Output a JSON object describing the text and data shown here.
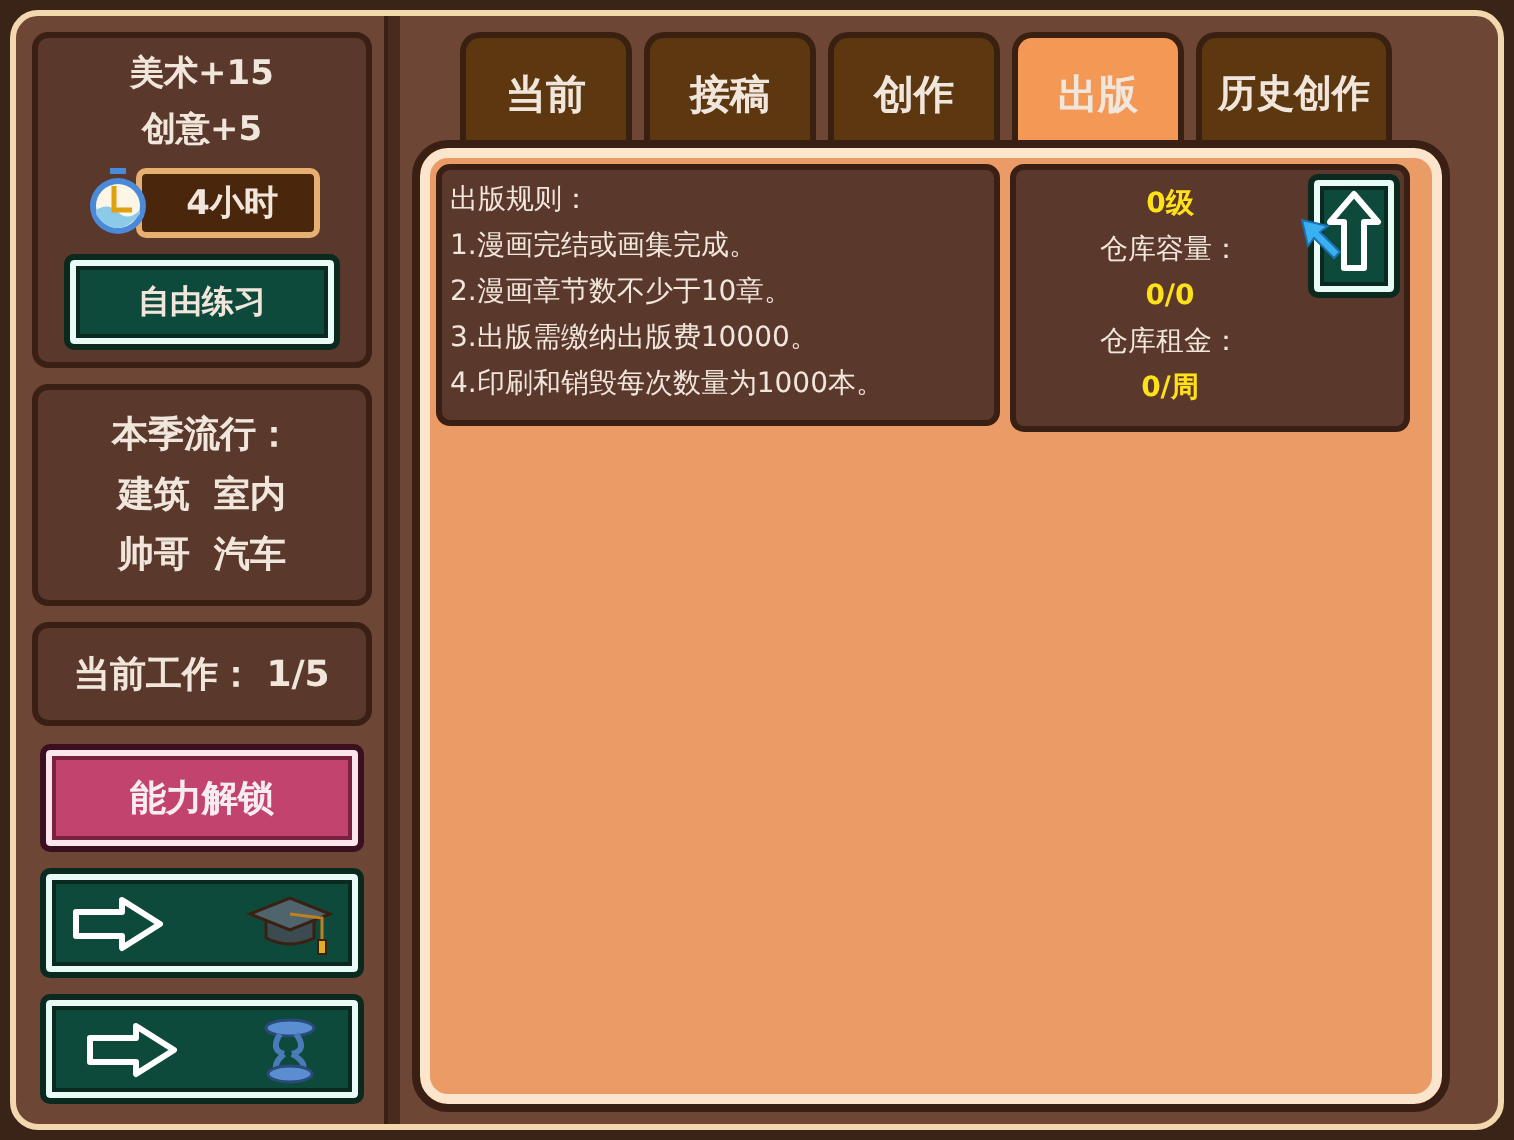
{
  "stats": [
    "美术+15",
    "创意+5"
  ],
  "timer": {
    "label": "4小时"
  },
  "practice_button": "自由练习",
  "trend": {
    "title": "本季流行：",
    "rows": [
      [
        "建筑",
        "室内"
      ],
      [
        "帅哥",
        "汽车"
      ]
    ]
  },
  "work": {
    "label": "当前工作：",
    "value": "1/5"
  },
  "unlock_button": "能力解锁",
  "nav_buttons": [
    {
      "kind": "graduation"
    },
    {
      "kind": "spring"
    }
  ],
  "tabs": [
    {
      "label": "当前",
      "selected": false
    },
    {
      "label": "接稿",
      "selected": false
    },
    {
      "label": "创作",
      "selected": false
    },
    {
      "label": "出版",
      "selected": true
    },
    {
      "label": "历史创作",
      "selected": false
    }
  ],
  "rules": {
    "title": "出版规则：",
    "items": [
      "1.漫画完结或画集完成。",
      "2.漫画章节数不少于10章。",
      "3.出版需缴纳出版费10000。",
      "4.印刷和销毁每次数量为1000本。"
    ]
  },
  "warehouse": {
    "level": "0级",
    "capacity_label": "仓库容量：",
    "capacity": "0/0",
    "rent_label": "仓库租金：",
    "rent": "0/周"
  }
}
